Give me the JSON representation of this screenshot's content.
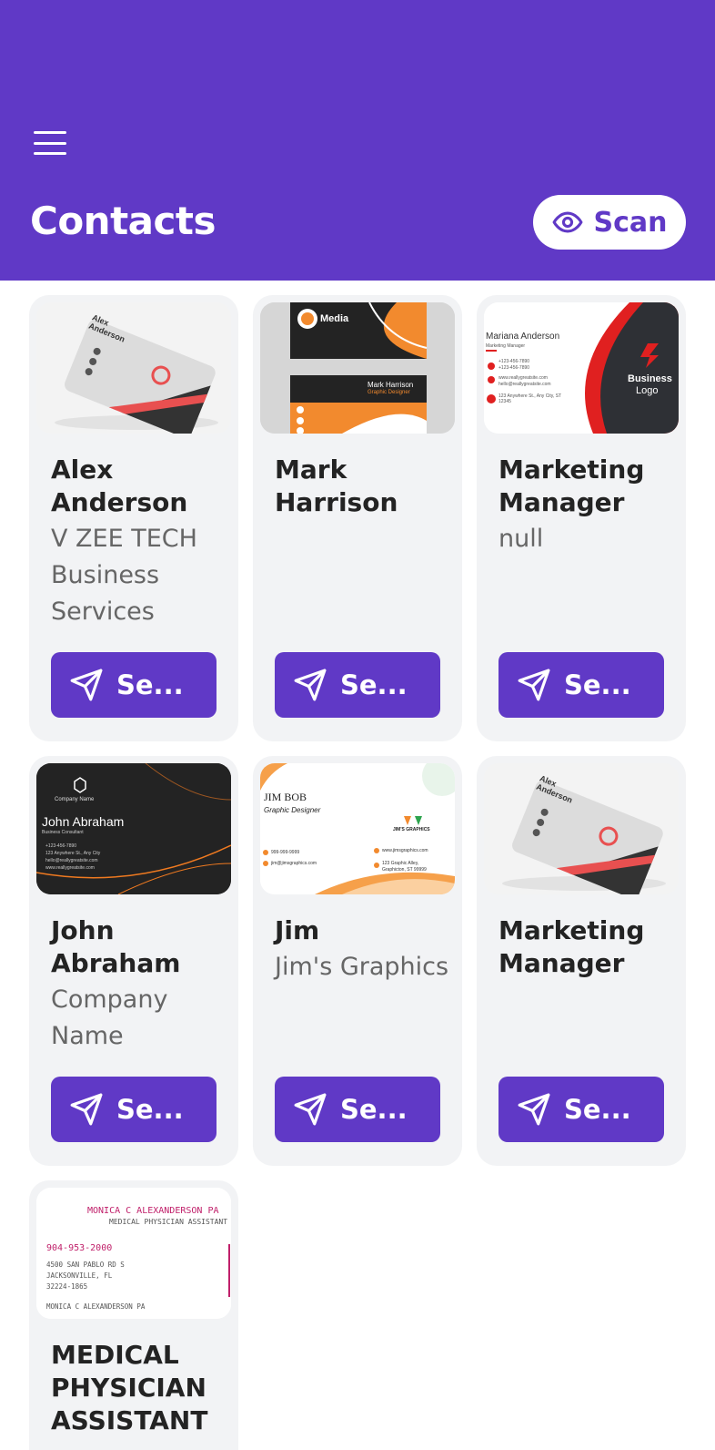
{
  "header": {
    "title": "Contacts",
    "scan_label": "Scan",
    "background": "#6039c6"
  },
  "colors": {
    "accent": "#6039c6",
    "card_bg": "#f2f3f5",
    "text_dark": "#232323",
    "text_muted": "#666666"
  },
  "contacts": [
    {
      "name": "Alex Anderson",
      "subtitle": "V ZEE TECH Business Services",
      "button_label": "Se...",
      "card_image_text": {
        "name": "Alex Anderson"
      }
    },
    {
      "name": "Mark Harrison",
      "subtitle": "",
      "button_label": "Se...",
      "card_image_text": {
        "brand": "Media",
        "name": "Mark Harrison",
        "role": "Graphic Designer"
      }
    },
    {
      "name": "Marketing Manager",
      "subtitle": "null",
      "button_label": "Se...",
      "card_image_text": {
        "name": "Mariana Anderson",
        "role": "Marketing Manager",
        "phone1": "+123-456-7890",
        "phone2": "+123-456-7890",
        "site": "www.reallygreatsite.com",
        "email": "hello@reallygreatsite.com",
        "address": "123 Anywhere St., Any City, ST 12345",
        "logo_line1": "Business",
        "logo_line2": "Logo"
      }
    },
    {
      "name": "John Abraham",
      "subtitle": "Company Name",
      "button_label": "Se...",
      "card_image_text": {
        "company": "Company Name",
        "name": "John Abraham",
        "role": "Business Consultant",
        "phone": "+123-456-7890",
        "address": "123 Anywhere St., Any City",
        "email": "hello@reallygreatsite.com",
        "site": "www.reallygreatsite.com"
      }
    },
    {
      "name": "Jim",
      "subtitle": "Jim's Graphics",
      "button_label": "Se...",
      "card_image_text": {
        "name": "JIM BOB",
        "role": "Graphic Designer",
        "logo": "JIM'S GRAPHICS",
        "phone": "999-999-9999",
        "email": "jim@jimsgraphics.com",
        "site": "www.jimsgraphics.com",
        "address1": "123 Graphic Alley,",
        "address2": "Graphicton, ST 99999"
      }
    },
    {
      "name": "Marketing Manager",
      "subtitle": "",
      "button_label": "Se...",
      "card_image_text": {
        "name": "Alex Anderson"
      }
    },
    {
      "name": "MEDICAL PHYSICIAN ASSISTANT",
      "subtitle": "",
      "button_label": "",
      "card_image_text": {
        "name": "MONICA C ALEXANDERSON PA",
        "role": "MEDICAL PHYSICIAN ASSISTANT",
        "phone": "904-953-2000",
        "address1": "4500 SAN PABLO RD S",
        "address2": "JACKSONVILLE, FL",
        "address3": "32224-1865",
        "footer": "MONICA C ALEXANDERSON PA"
      }
    }
  ]
}
